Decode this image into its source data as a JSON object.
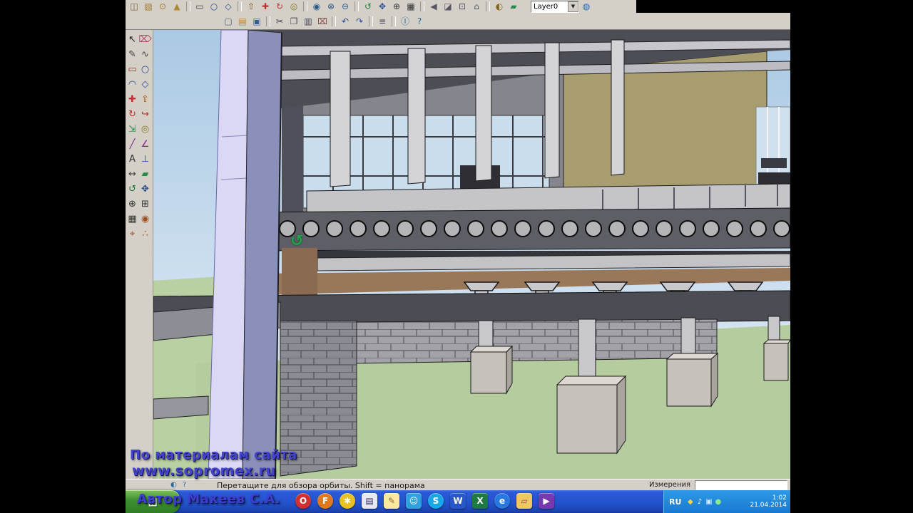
{
  "app": {
    "name": "SketchUp"
  },
  "toolbar_row1": {
    "icons": [
      {
        "name": "make-component-icon",
        "glyph": "◫",
        "color": "#7a5a30"
      },
      {
        "name": "box-tool-icon",
        "glyph": "▧",
        "color": "#a07828"
      },
      {
        "name": "cylinder-tool-icon",
        "glyph": "⊙",
        "color": "#a07828"
      },
      {
        "name": "cone-tool-icon",
        "glyph": "▲",
        "color": "#b08838"
      },
      {
        "sep": true
      },
      {
        "name": "rectangle-tool-icon",
        "glyph": "▭",
        "color": "#444444"
      },
      {
        "name": "circle-tool-icon",
        "glyph": "○",
        "color": "#2a4a9a"
      },
      {
        "name": "polygon-tool-icon",
        "glyph": "◇",
        "color": "#2a4a9a"
      },
      {
        "sep": true
      },
      {
        "name": "push-pull-icon",
        "glyph": "⇧",
        "color": "#8a5a2a"
      },
      {
        "name": "move-icon",
        "glyph": "✚",
        "color": "#c03030"
      },
      {
        "name": "rotate-icon",
        "glyph": "↻",
        "color": "#c03030"
      },
      {
        "name": "offset-icon",
        "glyph": "◎",
        "color": "#887722"
      },
      {
        "sep": true
      },
      {
        "name": "outer-shell-icon",
        "glyph": "◉",
        "color": "#2a5a8a"
      },
      {
        "name": "intersect-icon",
        "glyph": "⊗",
        "color": "#2a5a8a"
      },
      {
        "name": "subtract-icon",
        "glyph": "⊖",
        "color": "#2a5a8a"
      },
      {
        "sep": true
      },
      {
        "name": "orbit-icon",
        "glyph": "↺",
        "color": "#1a7a3a"
      },
      {
        "name": "pan-icon",
        "glyph": "✥",
        "color": "#2a4a8a"
      },
      {
        "name": "zoom-icon",
        "glyph": "⊕",
        "color": "#333333"
      },
      {
        "name": "zoom-extents-icon",
        "glyph": "▦",
        "color": "#333333"
      },
      {
        "sep": true
      },
      {
        "name": "previous-view-icon",
        "glyph": "◀",
        "color": "#555566"
      },
      {
        "name": "iso-view-icon",
        "glyph": "◪",
        "color": "#555566"
      },
      {
        "name": "top-view-icon",
        "glyph": "⊡",
        "color": "#555566"
      },
      {
        "name": "front-view-icon",
        "glyph": "⌂",
        "color": "#555566"
      },
      {
        "sep": true
      },
      {
        "name": "shadows-icon",
        "glyph": "◐",
        "color": "#886622"
      },
      {
        "name": "section-plane-icon",
        "glyph": "▰",
        "color": "#2a8a4a"
      }
    ],
    "layer_dropdown": {
      "value": "Layer0",
      "arrow": "▼"
    },
    "layer_manager_glyph": "◍"
  },
  "toolbar_row2": {
    "icons": [
      {
        "name": "new-icon",
        "glyph": "▢",
        "color": "#445566"
      },
      {
        "name": "open-icon",
        "glyph": "▤",
        "color": "#b8891f"
      },
      {
        "name": "save-icon",
        "glyph": "▣",
        "color": "#345a9a"
      },
      {
        "sep": true
      },
      {
        "name": "cut-icon",
        "glyph": "✂",
        "color": "#444455"
      },
      {
        "name": "copy-icon",
        "glyph": "❐",
        "color": "#444455"
      },
      {
        "name": "paste-icon",
        "glyph": "▥",
        "color": "#444455"
      },
      {
        "name": "erase-icon",
        "glyph": "⌧",
        "color": "#884444"
      },
      {
        "sep": true
      },
      {
        "name": "undo-icon",
        "glyph": "↶",
        "color": "#2a4a9a"
      },
      {
        "name": "redo-icon",
        "glyph": "↷",
        "color": "#2a4a9a"
      },
      {
        "sep": true
      },
      {
        "name": "print-icon",
        "glyph": "≡",
        "color": "#444455"
      },
      {
        "sep": true
      },
      {
        "name": "model-info-icon",
        "glyph": "Ⓘ",
        "color": "#2a6a9a"
      },
      {
        "name": "help-icon",
        "glyph": "?",
        "color": "#2a6a9a"
      }
    ]
  },
  "tool_palette": {
    "icons": [
      {
        "name": "select-icon",
        "glyph": "↖",
        "color": "#222222"
      },
      {
        "name": "eraser-icon",
        "glyph": "⌦",
        "color": "#aa4466"
      },
      {
        "name": "line-icon",
        "glyph": "✎",
        "color": "#444444"
      },
      {
        "name": "freehand-icon",
        "glyph": "∿",
        "color": "#444444"
      },
      {
        "name": "rectangle-icon",
        "glyph": "▭",
        "color": "#aa3322"
      },
      {
        "name": "circle-icon",
        "glyph": "○",
        "color": "#2a4a9a"
      },
      {
        "name": "arc-icon",
        "glyph": "◠",
        "color": "#2a4a9a"
      },
      {
        "name": "polygon-icon",
        "glyph": "◇",
        "color": "#2a4a9a"
      },
      {
        "name": "move-icon",
        "glyph": "✚",
        "color": "#c03030"
      },
      {
        "name": "push-pull-icon",
        "glyph": "⇧",
        "color": "#8a5a2a"
      },
      {
        "name": "rotate-icon",
        "glyph": "↻",
        "color": "#c03030"
      },
      {
        "name": "follow-me-icon",
        "glyph": "↪",
        "color": "#c03030"
      },
      {
        "name": "scale-icon",
        "glyph": "⇲",
        "color": "#2a8a4a"
      },
      {
        "name": "offset-icon",
        "glyph": "◎",
        "color": "#887722"
      },
      {
        "name": "tape-measure-icon",
        "glyph": "╱",
        "color": "#772288"
      },
      {
        "name": "protractor-icon",
        "glyph": "∠",
        "color": "#772288"
      },
      {
        "name": "text-icon",
        "glyph": "A",
        "color": "#333333"
      },
      {
        "name": "axes-icon",
        "glyph": "⊥",
        "color": "#2244cc"
      },
      {
        "name": "dimension-icon",
        "glyph": "↔",
        "color": "#444444"
      },
      {
        "name": "section-plane-icon",
        "glyph": "▰",
        "color": "#2a8a4a"
      },
      {
        "name": "orbit-icon",
        "glyph": "↺",
        "color": "#1a7a3a"
      },
      {
        "name": "pan-icon",
        "glyph": "✥",
        "color": "#2a4a8a"
      },
      {
        "name": "zoom-icon",
        "glyph": "⊕",
        "color": "#333333"
      },
      {
        "name": "zoom-window-icon",
        "glyph": "⊞",
        "color": "#333333"
      },
      {
        "name": "zoom-extents-icon",
        "glyph": "▦",
        "color": "#333333"
      },
      {
        "name": "position-camera-icon",
        "glyph": "◉",
        "color": "#a05020"
      },
      {
        "name": "look-around-icon",
        "glyph": "⌖",
        "color": "#a05020"
      },
      {
        "name": "walk-icon",
        "glyph": "∴",
        "color": "#a05020"
      }
    ]
  },
  "viewport": {
    "orbit_cursor_glyph": "↺"
  },
  "status_bar": {
    "icons": [
      {
        "name": "geolocation-icon",
        "glyph": "◐",
        "color": "#2a6a9a"
      },
      {
        "name": "help-status-icon",
        "glyph": "?",
        "color": "#2a6a9a"
      }
    ],
    "hint": "Перетащите для обзора орбиты.  Shift = панорама",
    "measurements_label": "Измерения",
    "measurements_value": ""
  },
  "taskbar": {
    "start_flag_glyph": "⊞",
    "quick_launch": [
      {
        "name": "opera-icon",
        "glyph": "O",
        "bg": "#d03030",
        "round": true
      },
      {
        "name": "firefox-icon",
        "glyph": "F",
        "bg": "#e07820",
        "round": true
      },
      {
        "name": "chat-icon",
        "glyph": "✱",
        "bg": "#e8c020",
        "round": true
      },
      {
        "name": "notepad-icon",
        "glyph": "▤",
        "bg": "#e8e8f0",
        "color": "#336"
      },
      {
        "name": "pencil-icon",
        "glyph": "✎",
        "bg": "#ffe9a0",
        "color": "#863"
      },
      {
        "name": "messenger-icon",
        "glyph": "☺",
        "bg": "#30a0e0"
      },
      {
        "name": "skype-icon",
        "glyph": "S",
        "bg": "#18a8e8",
        "round": true
      },
      {
        "name": "word-icon",
        "glyph": "W",
        "bg": "#2858c8"
      },
      {
        "name": "excel-icon",
        "glyph": "X",
        "bg": "#1e7a40"
      },
      {
        "name": "ie-icon",
        "glyph": "e",
        "bg": "#2878e0",
        "round": true
      },
      {
        "name": "folder-icon",
        "glyph": "▱",
        "bg": "#f0c860",
        "color": "#946"
      },
      {
        "name": "media-player-icon",
        "glyph": "▶",
        "bg": "#7838b0"
      }
    ],
    "tray": {
      "language": "RU",
      "icons": [
        {
          "name": "shield-icon",
          "glyph": "◆",
          "color": "#ffd24a"
        },
        {
          "name": "volume-icon",
          "glyph": "♪",
          "color": "#ffffff"
        },
        {
          "name": "network-icon",
          "glyph": "▣",
          "color": "#cfe6ff"
        },
        {
          "name": "safely-remove-icon",
          "glyph": "●",
          "color": "#8de88d"
        }
      ],
      "time": "1:02",
      "date": "21.04.2014"
    }
  },
  "watermark": {
    "line1": "По материалам сайта",
    "line2": "www.sopromex.ru",
    "line3": "Автор Макеев С.А."
  },
  "colors": {
    "toolbar_bg": "#d4d0c8",
    "taskbar_blue": "#2453cc",
    "start_green": "#3d8f2f",
    "sky": "#bcd6ec",
    "ground_green": "#b5cd9e",
    "slab_grey": "#5e5e66",
    "watermark_blue": "#4343cf"
  }
}
